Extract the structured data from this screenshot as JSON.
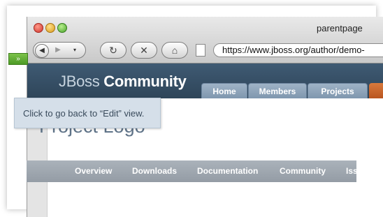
{
  "browser": {
    "title": "parentpage",
    "url": "https://www.jboss.org/author/demo-"
  },
  "site": {
    "logo_prefix": "JBoss",
    "logo_main": "Community",
    "edit_toggle": "»",
    "tabs": [
      "Home",
      "Members",
      "Projects"
    ]
  },
  "page": {
    "title": "Project Logo",
    "subnav": [
      "Overview",
      "Downloads",
      "Documentation",
      "Community",
      "Issue T"
    ]
  },
  "tooltip": {
    "text": "Click to go back to “Edit” view."
  },
  "colors": {
    "header": "#2e4559",
    "edit_button": "#4d9a26",
    "tab": "#8aa0b6",
    "tab_accent": "#c8642a",
    "subnav": "#9ea6ae",
    "tooltip": "#d5dfe9"
  }
}
